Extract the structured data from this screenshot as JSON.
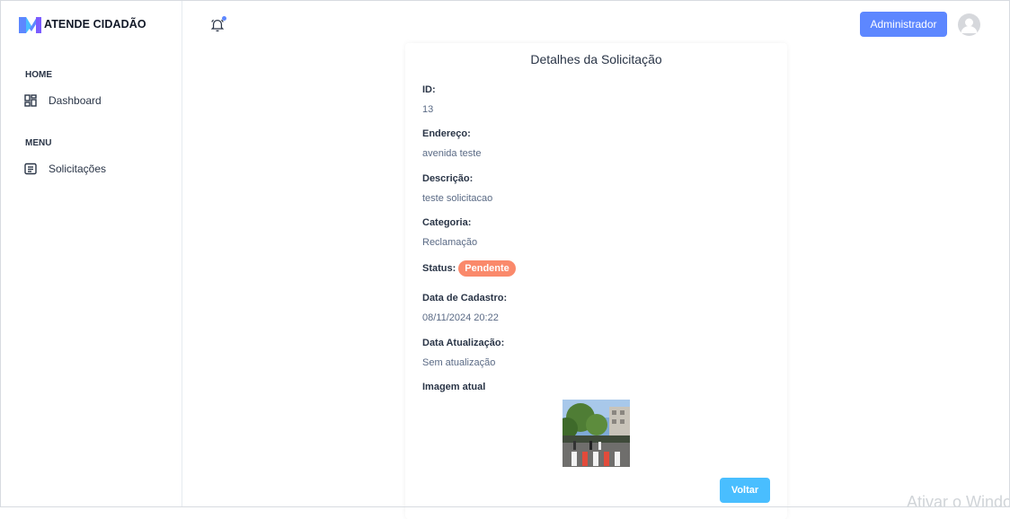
{
  "brand": {
    "name": "ATENDE CIDADÃO",
    "logo_icon": "brand-logo-icon"
  },
  "sidebar": {
    "sections": [
      {
        "title": "HOME",
        "items": [
          {
            "label": "Dashboard",
            "icon": "dashboard-icon"
          }
        ]
      },
      {
        "title": "MENU",
        "items": [
          {
            "label": "Solicitações",
            "icon": "list-icon"
          }
        ]
      }
    ]
  },
  "header": {
    "notification_icon": "bell-icon",
    "user_button": "Administrador",
    "avatar_icon": "avatar-icon"
  },
  "details": {
    "title": "Detalhes da Solicitação",
    "id_label": "ID:",
    "id_value": "13",
    "address_label": "Endereço:",
    "address_value": "avenida teste",
    "description_label": "Descrição:",
    "description_value": "teste solicitacao",
    "category_label": "Categoria:",
    "category_value": "Reclamação",
    "status_label": "Status:",
    "status_value": "Pendente",
    "created_label": "Data de Cadastro:",
    "created_value": "08/11/2024 20:22",
    "updated_label": "Data Atualização:",
    "updated_value": "Sem atualização",
    "image_label": "Imagem atual",
    "back_button": "Voltar"
  },
  "colors": {
    "primary": "#5d87ff",
    "secondary": "#49beff",
    "warning_badge": "#fa896b"
  },
  "watermark": "Ativar o Windows"
}
